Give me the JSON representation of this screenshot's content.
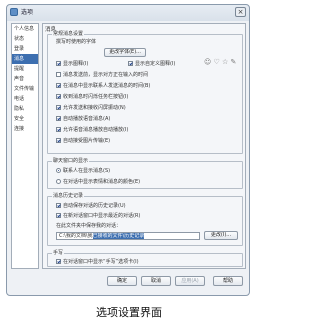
{
  "window": {
    "title": "选项",
    "close_label": "×"
  },
  "sidebar": {
    "items": [
      {
        "label": "个人信息"
      },
      {
        "label": "状态"
      },
      {
        "label": "登录"
      },
      {
        "label": "消息"
      },
      {
        "label": "提醒"
      },
      {
        "label": "声音"
      },
      {
        "label": "文件传输"
      },
      {
        "label": "电话"
      },
      {
        "label": "隐私"
      },
      {
        "label": "安全"
      },
      {
        "label": "连接"
      }
    ]
  },
  "main": {
    "section_title": "消息",
    "general": {
      "title": "常规消息设置",
      "font_label": "撰写时使用的字体",
      "font_button": "更改字体(E)...",
      "show_emoticons": "显示图释(I)",
      "show_custom_emoticons": "显示自定义图释(I)",
      "emoticons_icons": "☺ ♡ ☆ ✎",
      "check1": "消息发送前，显示对方正在输入的时间",
      "check2": "在消息中显示联系人发送消息的时间(B)",
      "check3": "收到消息时闪烁任务栏按钮(I)",
      "check4": "允许发送和接收闪屏振动(N)",
      "check5": "自动播放语音消息(A)",
      "check6": "允许语音消息播放自动播放(I)",
      "check7": "自动接受图片传输(E)"
    },
    "display": {
      "title": "聊天窗口的显示",
      "radio1": "联系人在显示消息(S)",
      "radio2": "在对话中显示表情和消息的颜色(E)"
    },
    "history": {
      "title": "消息历史记录",
      "check1": "自动保存对话的历史记录(U)",
      "check2": "在新对话窗口中显示最近的对话(R)",
      "path_label": "在此文件夹中保存我的对话：",
      "path_prefix": "C:\\我的文档\\我",
      "path_selected": "已接收的文件\\历史记录",
      "change_button": "更改(I)..."
    },
    "handwriting": {
      "title": "手写",
      "check1": "在对话窗口中显示“手写”选项卡(I)"
    }
  },
  "footer": {
    "ok": "确定",
    "cancel": "取消",
    "apply": "应用(A)",
    "help": "帮助"
  },
  "caption": "选项设置界面"
}
